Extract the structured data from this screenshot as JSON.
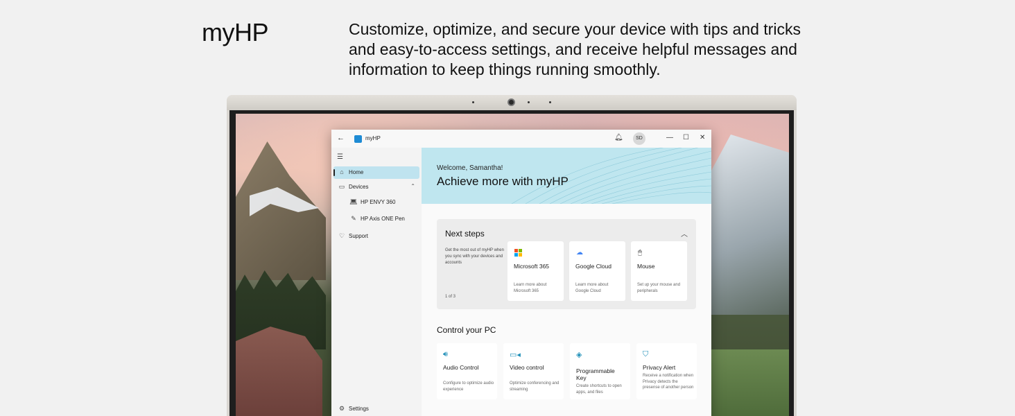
{
  "page": {
    "title": "myHP",
    "tagline": "Customize, optimize, and secure your device with tips and tricks and easy-to-access settings, and receive helpful messages and information to keep things running smoothly."
  },
  "app": {
    "name": "myHP",
    "avatar_initials": "SD",
    "sidebar": {
      "items": [
        {
          "label": "Home",
          "icon": "home-icon"
        },
        {
          "label": "Devices",
          "icon": "devices-icon"
        },
        {
          "label": "HP ENVY 360",
          "icon": "laptop-icon"
        },
        {
          "label": "HP Axis ONE Pen",
          "icon": "pen-icon"
        },
        {
          "label": "Support",
          "icon": "support-icon"
        }
      ],
      "settings_label": "Settings"
    },
    "hero": {
      "welcome": "Welcome, Samantha!",
      "title": "Achieve more with myHP"
    },
    "next_steps": {
      "title": "Next steps",
      "description": "Get the most out of myHP when you sync with your devices and accounts",
      "page_indicator": "1 of 3",
      "tiles": [
        {
          "title": "Microsoft 365",
          "desc": "Learn more about Microsoft 365"
        },
        {
          "title": "Google Cloud",
          "desc": "Learn more about Google Cloud"
        },
        {
          "title": "Mouse",
          "desc": "Set up your mouse and peripherals"
        }
      ]
    },
    "control": {
      "title": "Control your PC",
      "tiles": [
        {
          "title": "Audio Control",
          "desc": "Configure to optimize audio experience",
          "icon": "speaker-icon"
        },
        {
          "title": "Video control",
          "desc": "Optimize conferencing and streaming",
          "icon": "video-icon"
        },
        {
          "title": "Programmable Key",
          "desc": "Create shortcuts to open apps, and files",
          "icon": "key-icon"
        },
        {
          "title": "Privacy Alert",
          "desc": "Receive a notification when Privacy detects the presense of another person",
          "icon": "shield-icon"
        }
      ]
    }
  },
  "colors": {
    "accent": "#1f8fb8",
    "hero_bg": "#bfe6ef",
    "nav_active": "#bfe3ef"
  }
}
